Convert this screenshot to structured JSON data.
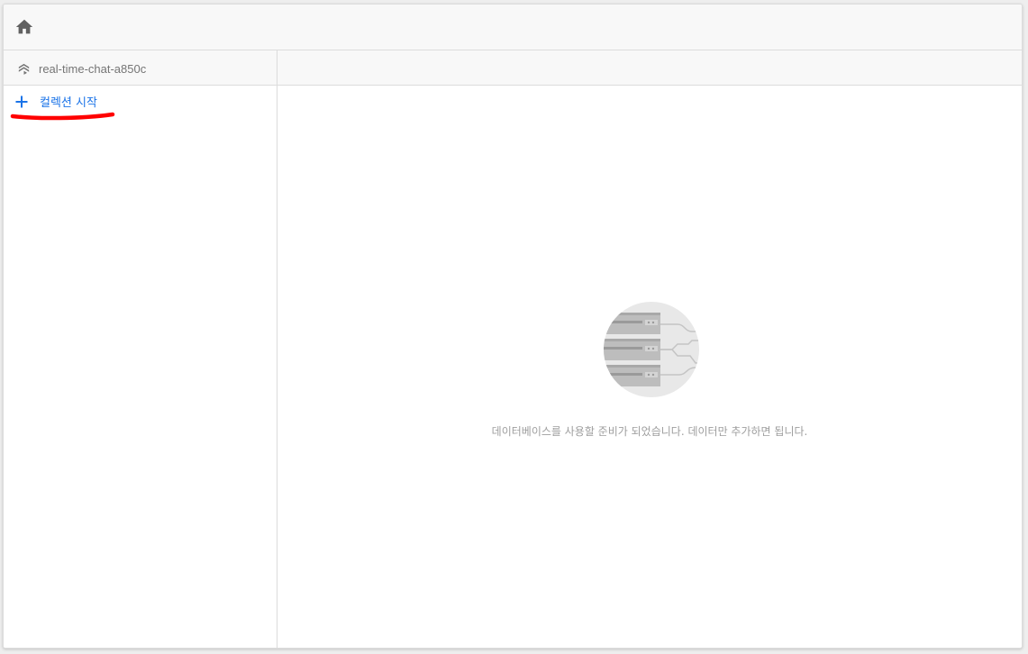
{
  "header": {
    "home_icon": "home-icon"
  },
  "project": {
    "icon": "firestore-icon",
    "name": "real-time-chat-a850c"
  },
  "left_panel": {
    "start_collection_icon": "plus-icon",
    "start_collection_label": "컬렉션 시작",
    "annotation_color": "#ff0000"
  },
  "main": {
    "illustration": "database-servers-illustration",
    "empty_message": "데이터베이스를 사용할 준비가 되었습니다. 데이터만 추가하면 됩니다."
  },
  "colors": {
    "accent": "#1a73e8",
    "muted_text": "#9e9e9e",
    "header_bg": "#f8f8f8"
  }
}
